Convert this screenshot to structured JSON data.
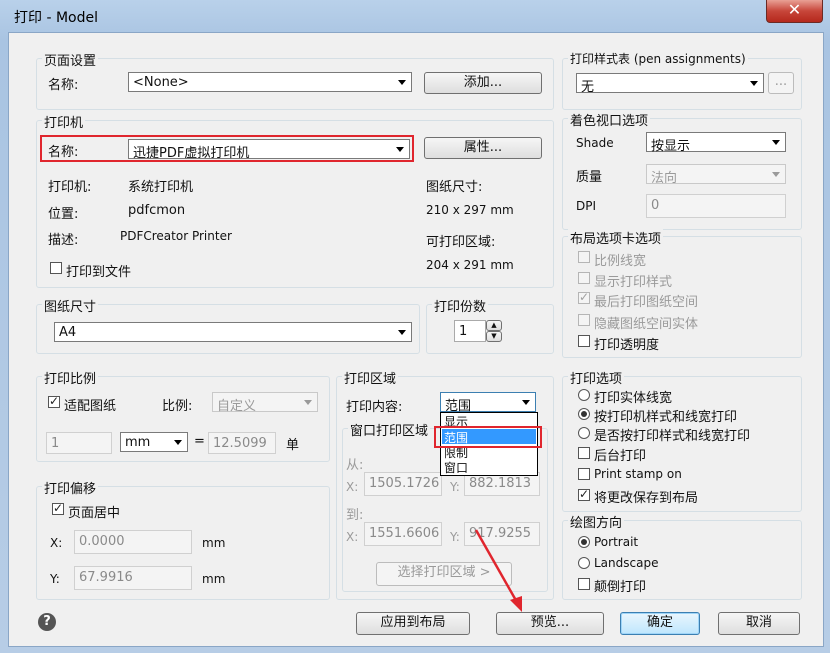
{
  "window": {
    "title": "打印 - Model",
    "close": "✕"
  },
  "page_setup": {
    "group": "页面设置",
    "name_label": "名称:",
    "name_value": "<None>",
    "add_button": "添加..."
  },
  "printer": {
    "group": "打印机",
    "name_label": "名称:",
    "name_value": "迅捷PDF虚拟打印机",
    "properties_button": "属性...",
    "plotter_label": "打印机:",
    "plotter_value": "系统打印机",
    "where_label": "位置:",
    "where_value": "pdfcmon",
    "desc_label": "描述:",
    "desc_value": "PDFCreator Printer",
    "paper_size_label": "图纸尺寸:",
    "paper_size_value": "210 x 297 mm",
    "printable_label": "可打印区域:",
    "printable_value": "204 x 291 mm",
    "print_to_file": "打印到文件"
  },
  "paper_size": {
    "group": "图纸尺寸",
    "value": "A4"
  },
  "copies": {
    "group": "打印份数",
    "value": "1"
  },
  "plot_scale": {
    "group": "打印比例",
    "fit_to_paper": "适配图纸",
    "scale_label": "比例:",
    "scale_value": "自定义",
    "val1": "1",
    "unit": "mm",
    "equals": "=",
    "val2": "12.5099",
    "unit2": "单"
  },
  "plot_offset": {
    "group": "打印偏移",
    "center": "页面居中",
    "x_label": "X:",
    "x_value": "0.0000",
    "x_unit": "mm",
    "y_label": "Y:",
    "y_value": "67.9916",
    "y_unit": "mm"
  },
  "plot_area": {
    "group": "打印区域",
    "what_label": "打印内容:",
    "what_value": "范围",
    "options": [
      "显示",
      "范围",
      "限制",
      "窗口"
    ],
    "window_label": "窗口打印区域",
    "from_label": "从:",
    "to_label": "到:",
    "from_x": "1505.1726",
    "from_y": "882.1813",
    "to_x": "1551.6606",
    "to_y": "917.9255",
    "x_label": "X:",
    "y_label": "Y:",
    "select_button": "选择打印区域 >"
  },
  "style_table": {
    "group": "打印样式表 (pen assignments)",
    "value": "无",
    "edit_button": "..."
  },
  "shaded": {
    "group": "着色视口选项",
    "shade_label": "Shade",
    "shade_value": "按显示",
    "quality_label": "质量",
    "quality_value": "法向",
    "dpi_label": "DPI",
    "dpi_value": "0"
  },
  "layout_options": {
    "group": "布局选项卡选项",
    "items": [
      "比例线宽",
      "显示打印样式",
      "最后打印图纸空间",
      "隐藏图纸空间实体",
      "打印透明度"
    ]
  },
  "plot_options": {
    "group": "打印选项",
    "radios": [
      "打印实体线宽",
      "按打印机样式和线宽打印",
      "是否按打印样式和线宽打印"
    ],
    "checks": [
      "后台打印",
      "Print stamp on",
      "将更改保存到布局"
    ]
  },
  "orientation": {
    "group": "绘图方向",
    "portrait": "Portrait",
    "landscape": "Landscape",
    "upside_down": "颠倒打印"
  },
  "footer": {
    "help": "?",
    "apply": "应用到布局",
    "preview": "预览...",
    "ok": "确定",
    "cancel": "取消"
  },
  "colors": {
    "highlight_box": "#e0262e",
    "selection": "#3399ff",
    "annotation_arrow": "#e0262e"
  }
}
